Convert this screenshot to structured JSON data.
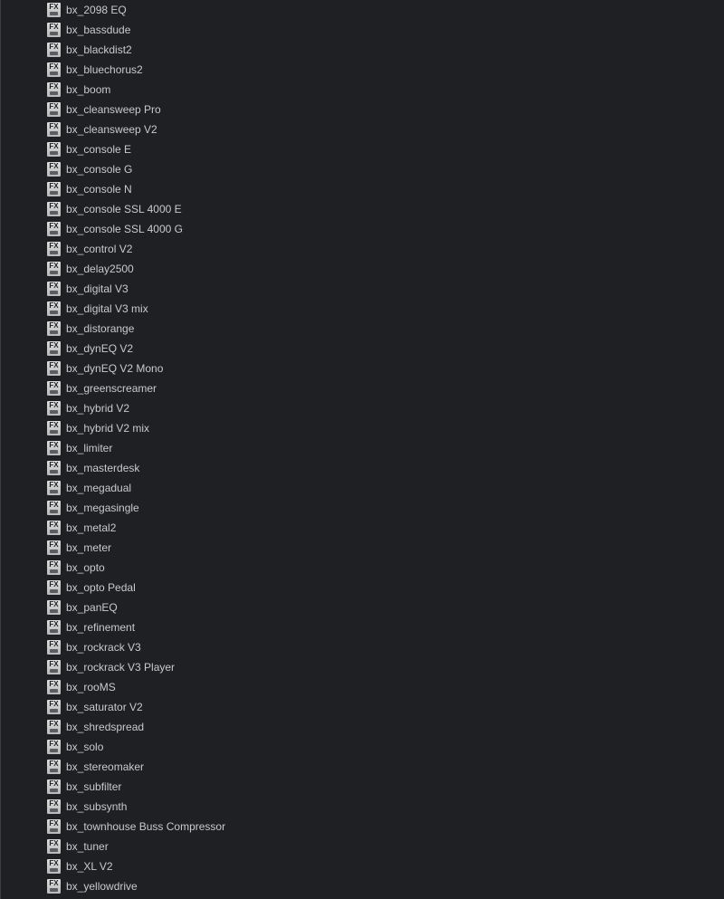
{
  "icon_text": "FX",
  "icon_name": "fx-plugin-icon",
  "colors": {
    "background": "#1e2023",
    "text": "#c8cacd",
    "icon": "#cfcfcf"
  },
  "plugins": [
    "bx_2098 EQ",
    "bx_bassdude",
    "bx_blackdist2",
    "bx_bluechorus2",
    "bx_boom",
    "bx_cleansweep Pro",
    "bx_cleansweep V2",
    "bx_console E",
    "bx_console G",
    "bx_console N",
    "bx_console SSL 4000 E",
    "bx_console SSL 4000 G",
    "bx_control V2",
    "bx_delay2500",
    "bx_digital V3",
    "bx_digital V3 mix",
    "bx_distorange",
    "bx_dynEQ V2",
    "bx_dynEQ V2 Mono",
    "bx_greenscreamer",
    "bx_hybrid V2",
    "bx_hybrid V2 mix",
    "bx_limiter",
    "bx_masterdesk",
    "bx_megadual",
    "bx_megasingle",
    "bx_metal2",
    "bx_meter",
    "bx_opto",
    "bx_opto Pedal",
    "bx_panEQ",
    "bx_refinement",
    "bx_rockrack V3",
    "bx_rockrack V3 Player",
    "bx_rooMS",
    "bx_saturator V2",
    "bx_shredspread",
    "bx_solo",
    "bx_stereomaker",
    "bx_subfilter",
    "bx_subsynth",
    "bx_townhouse Buss Compressor",
    "bx_tuner",
    "bx_XL V2",
    "bx_yellowdrive"
  ]
}
